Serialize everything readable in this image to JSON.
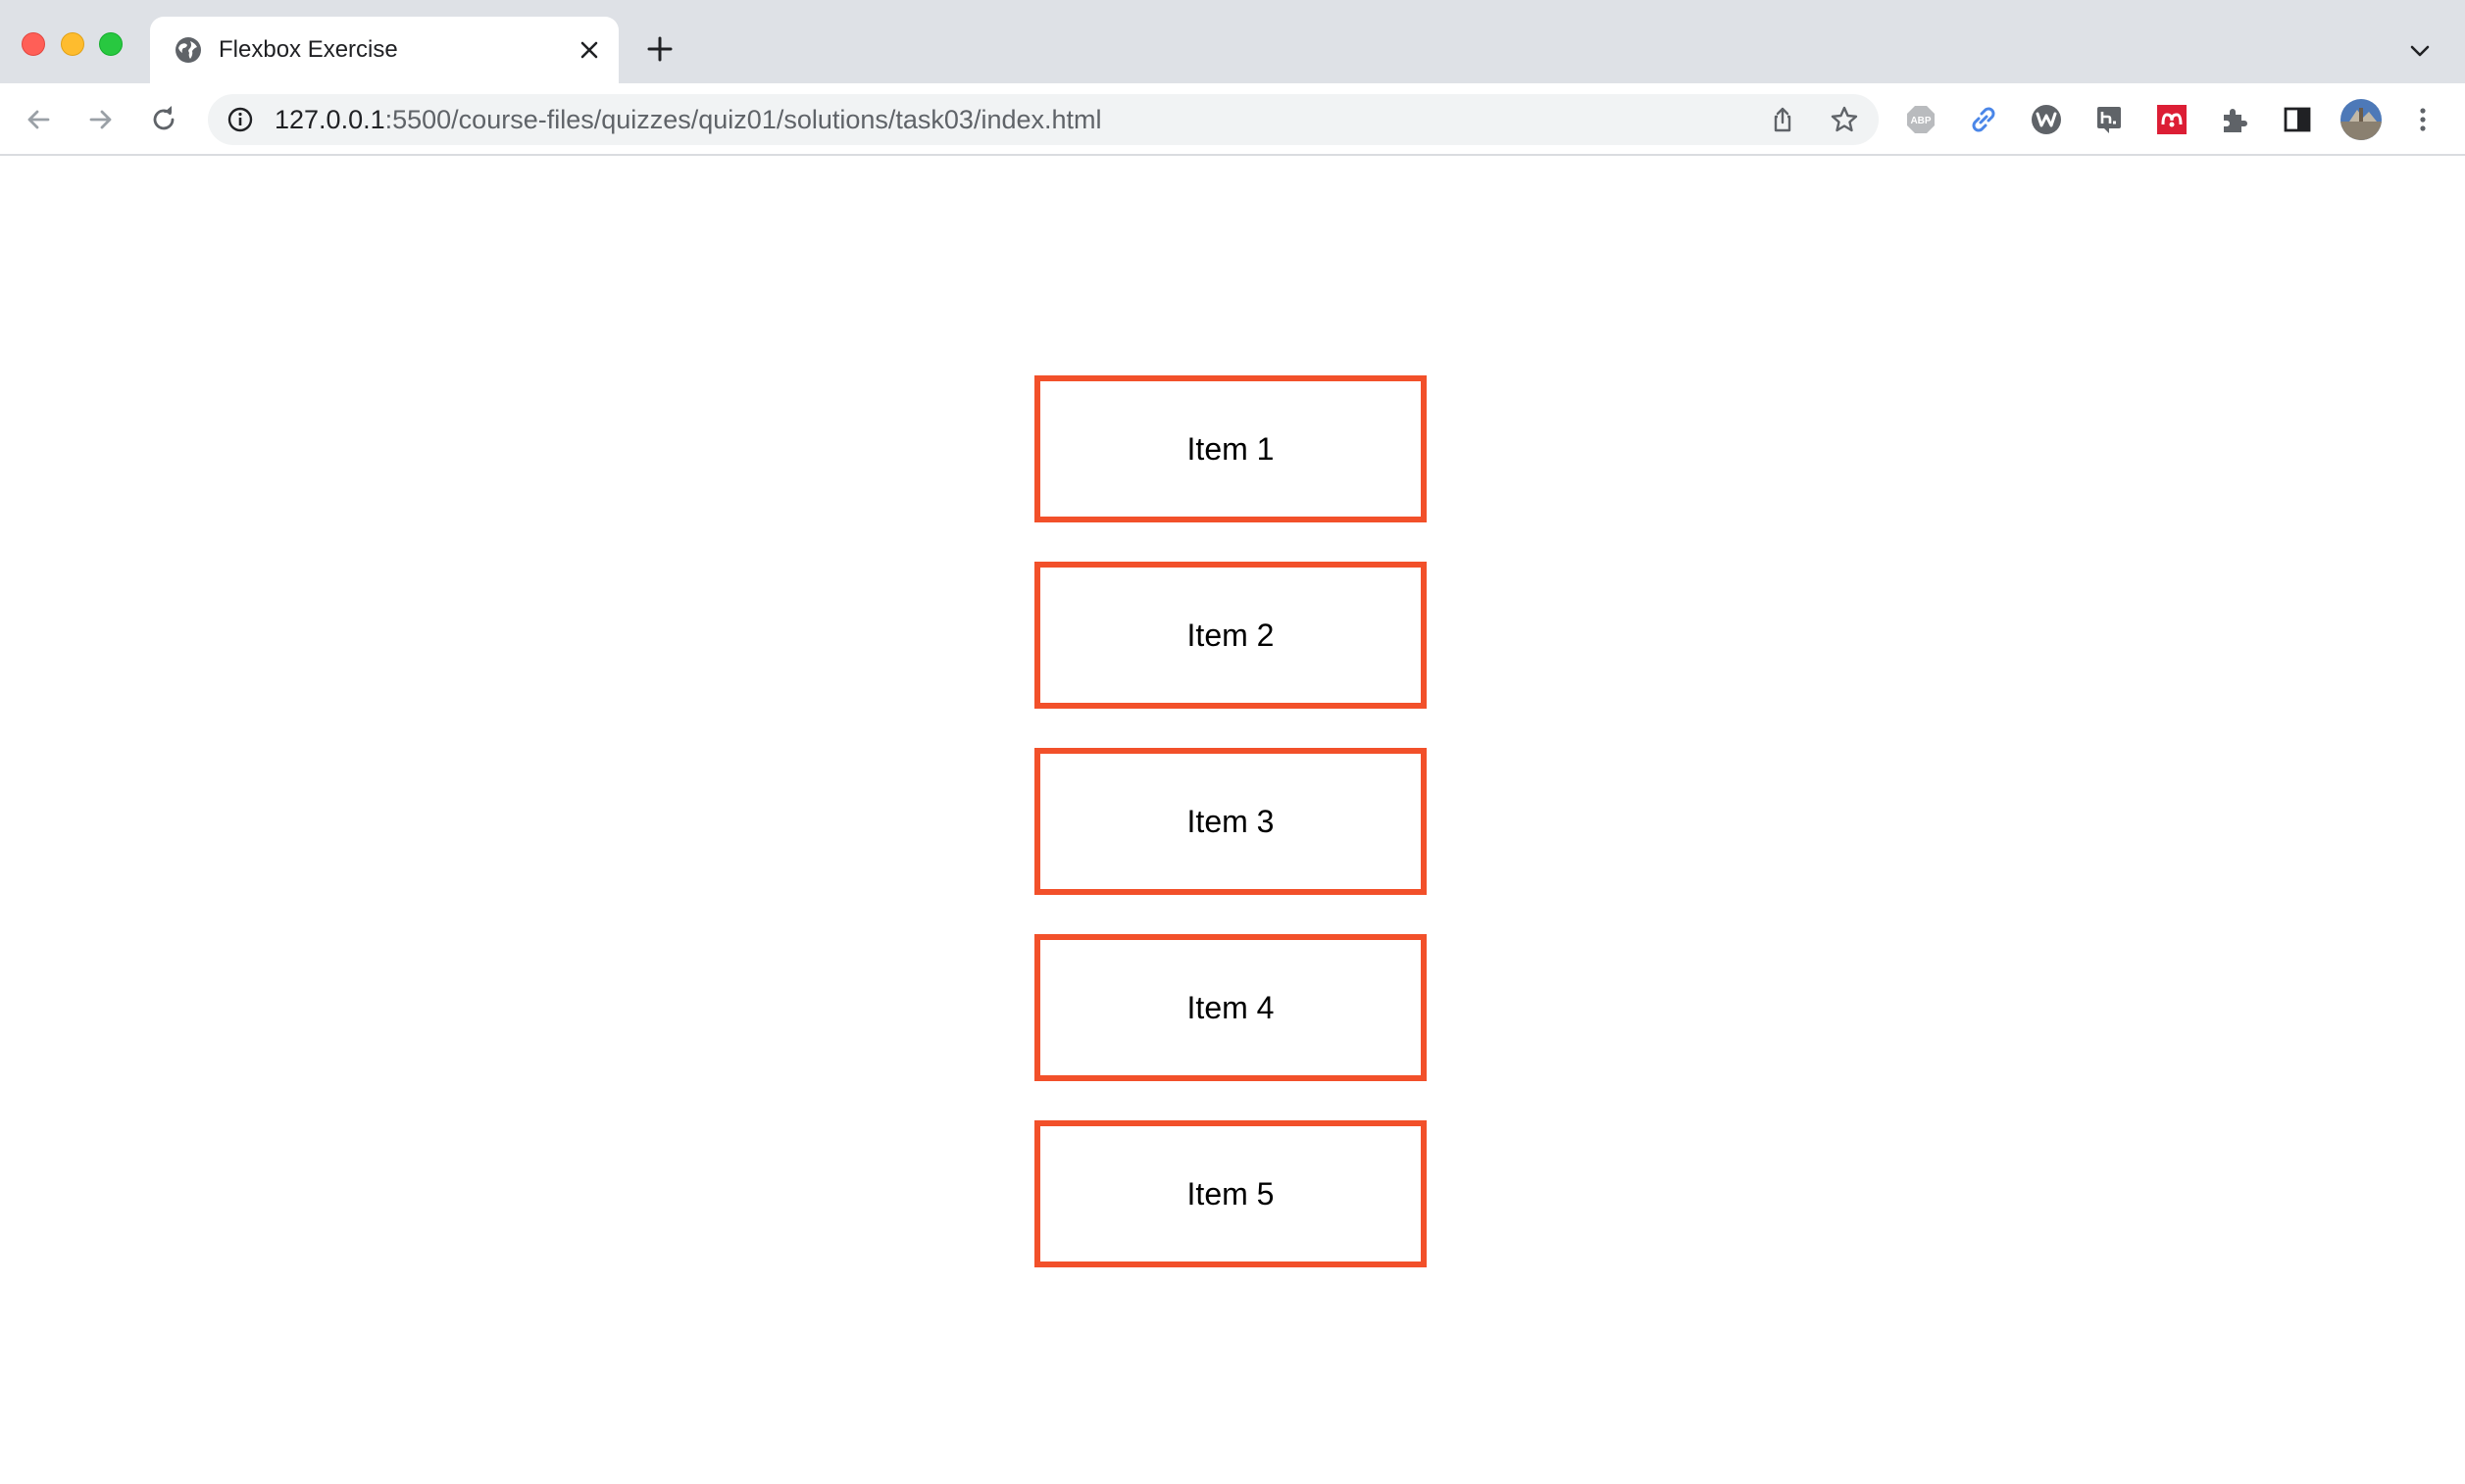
{
  "browser": {
    "tab": {
      "title": "Flexbox Exercise",
      "favicon": "globe-icon"
    },
    "address_bar": {
      "host": "127.0.0.1",
      "path": ":5500/course-files/quizzes/quiz01/solutions/task03/index.html"
    },
    "extensions": [
      "adblock-plus-icon",
      "link-icon",
      "wordtune-icon",
      "hypothesis-icon",
      "mendeley-icon",
      "puzzle-icon",
      "side-panel-icon"
    ]
  },
  "page": {
    "items": [
      {
        "label": "Item 1"
      },
      {
        "label": "Item 2"
      },
      {
        "label": "Item 3"
      },
      {
        "label": "Item 4"
      },
      {
        "label": "Item 5"
      }
    ],
    "accent_color": "#f2502a"
  }
}
